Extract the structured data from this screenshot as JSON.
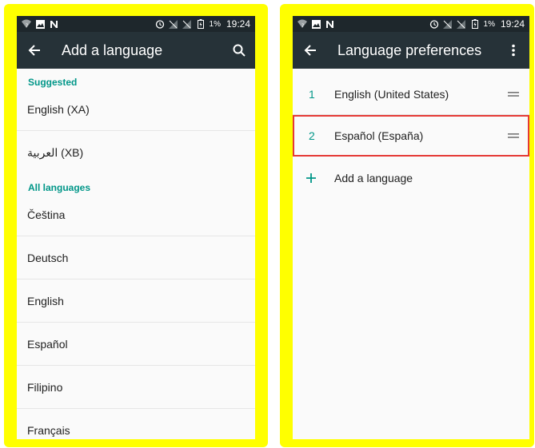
{
  "left_screen": {
    "status": {
      "battery": "1%",
      "time": "19:24"
    },
    "appbar": {
      "title": "Add a language"
    },
    "suggested_header": "Suggested",
    "suggested": [
      "English (XA)",
      "العربية (XB)"
    ],
    "all_header": "All languages",
    "all_languages": [
      "Čeština",
      "Deutsch",
      "English",
      "Español",
      "Filipino",
      "Français"
    ]
  },
  "right_screen": {
    "status": {
      "battery": "1%",
      "time": "19:24"
    },
    "appbar": {
      "title": "Language preferences"
    },
    "preferences": [
      {
        "num": "1",
        "label": "English (United States)"
      },
      {
        "num": "2",
        "label": "Español (España)"
      }
    ],
    "add_label": "Add a language"
  },
  "colors": {
    "accent": "#009688",
    "appbar": "#263238",
    "statusbar": "#1e272c",
    "frame": "#ffff00",
    "highlight": "#e53935"
  }
}
